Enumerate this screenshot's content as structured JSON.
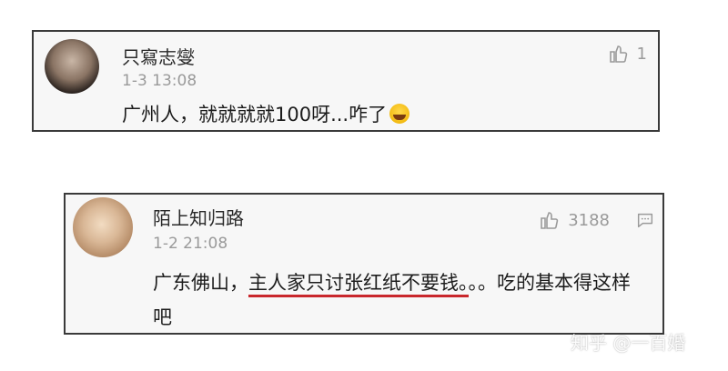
{
  "comments": [
    {
      "username": "只寫志燮",
      "timestamp": "1-3 13:08",
      "likes": "1",
      "text": "广州人，就就就就100呀...咋了"
    },
    {
      "username": "陌上知归路",
      "timestamp": "1-2 21:08",
      "likes": "3188",
      "text_before": "广东佛山，",
      "text_underlined": "主人家只讨张红纸不要钱。",
      "text_after": "。。吃的基本得这样吧"
    }
  ],
  "watermark": "知乎 @一百婚",
  "icons": {
    "avatar_1": "avatar",
    "avatar_2": "avatar",
    "like": "thumbs-up-icon",
    "reply": "reply-icon",
    "emoji": "laughing-emoji-icon"
  },
  "colors": {
    "underline": "#c9272c",
    "card_border": "#3a3a3a",
    "meta_text": "#9a9a9a"
  }
}
